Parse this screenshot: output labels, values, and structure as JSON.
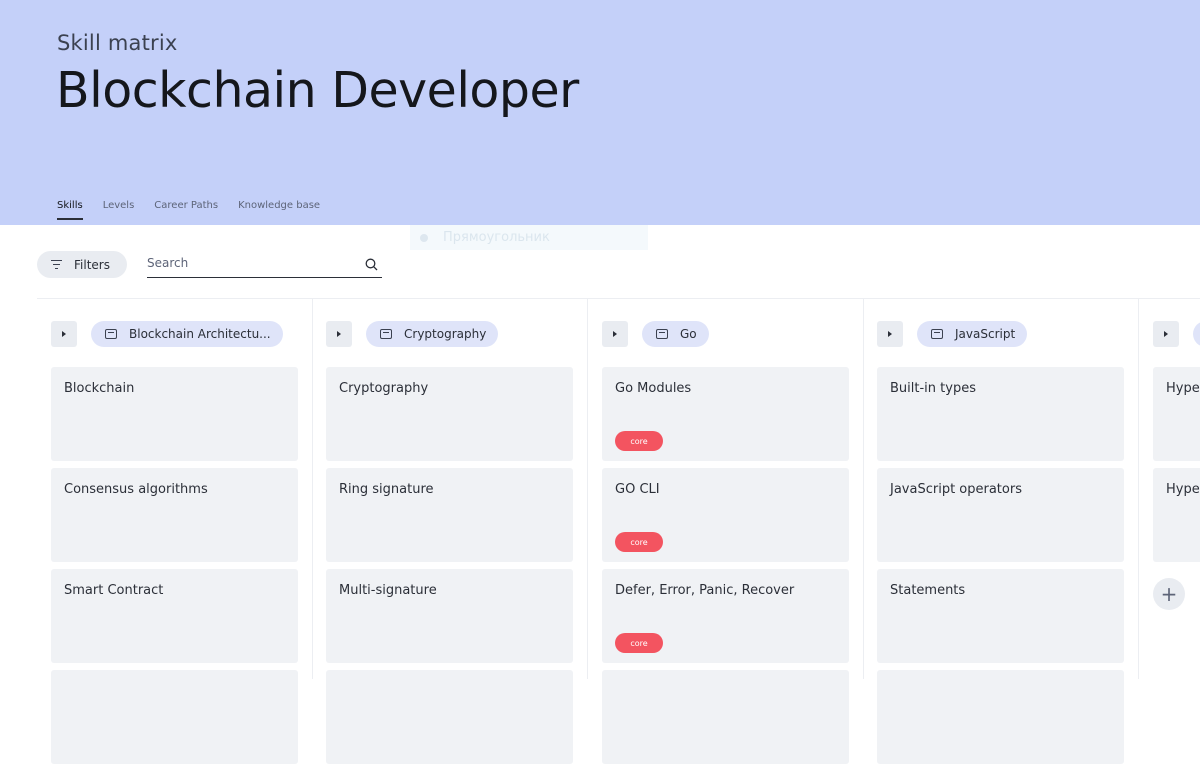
{
  "header": {
    "subtitle": "Skill matrix",
    "title": "Blockchain Developer"
  },
  "tabs": [
    {
      "label": "Skills",
      "active": true
    },
    {
      "label": "Levels",
      "active": false
    },
    {
      "label": "Career Paths",
      "active": false
    },
    {
      "label": "Knowledge base",
      "active": false
    }
  ],
  "ghost_label": "Прямоугольник",
  "toolbar": {
    "filters_label": "Filters",
    "search_placeholder": "Search",
    "search_value": ""
  },
  "columns": [
    {
      "name": "Blockchain Architectu...",
      "cards": [
        {
          "label": "Blockchain",
          "badge": ""
        },
        {
          "label": "Consensus algorithms",
          "badge": ""
        },
        {
          "label": "Smart Contract",
          "badge": ""
        },
        {
          "label": "",
          "badge": ""
        }
      ]
    },
    {
      "name": "Cryptography",
      "cards": [
        {
          "label": "Cryptography",
          "badge": ""
        },
        {
          "label": "Ring signature",
          "badge": ""
        },
        {
          "label": "Multi-signature",
          "badge": ""
        },
        {
          "label": "",
          "badge": ""
        }
      ]
    },
    {
      "name": "Go",
      "cards": [
        {
          "label": "Go Modules",
          "badge": "core"
        },
        {
          "label": "GO CLI",
          "badge": "core"
        },
        {
          "label": "Defer, Error, Panic, Recover",
          "badge": "core"
        },
        {
          "label": "",
          "badge": ""
        }
      ]
    },
    {
      "name": "JavaScript",
      "cards": [
        {
          "label": "Built-in types",
          "badge": ""
        },
        {
          "label": "JavaScript operators",
          "badge": ""
        },
        {
          "label": "Statements",
          "badge": ""
        },
        {
          "label": "",
          "badge": ""
        }
      ]
    },
    {
      "name": "",
      "cards": [
        {
          "label": "Hype",
          "badge": ""
        },
        {
          "label": "Hype",
          "badge": ""
        }
      ]
    }
  ],
  "add_card_icon": "plus-icon",
  "colors": {
    "header_bg": "#c4d0f9",
    "badge_core": "#f35460",
    "card_bg": "#f0f2f5",
    "chip_bg": "#dfe4f9"
  }
}
